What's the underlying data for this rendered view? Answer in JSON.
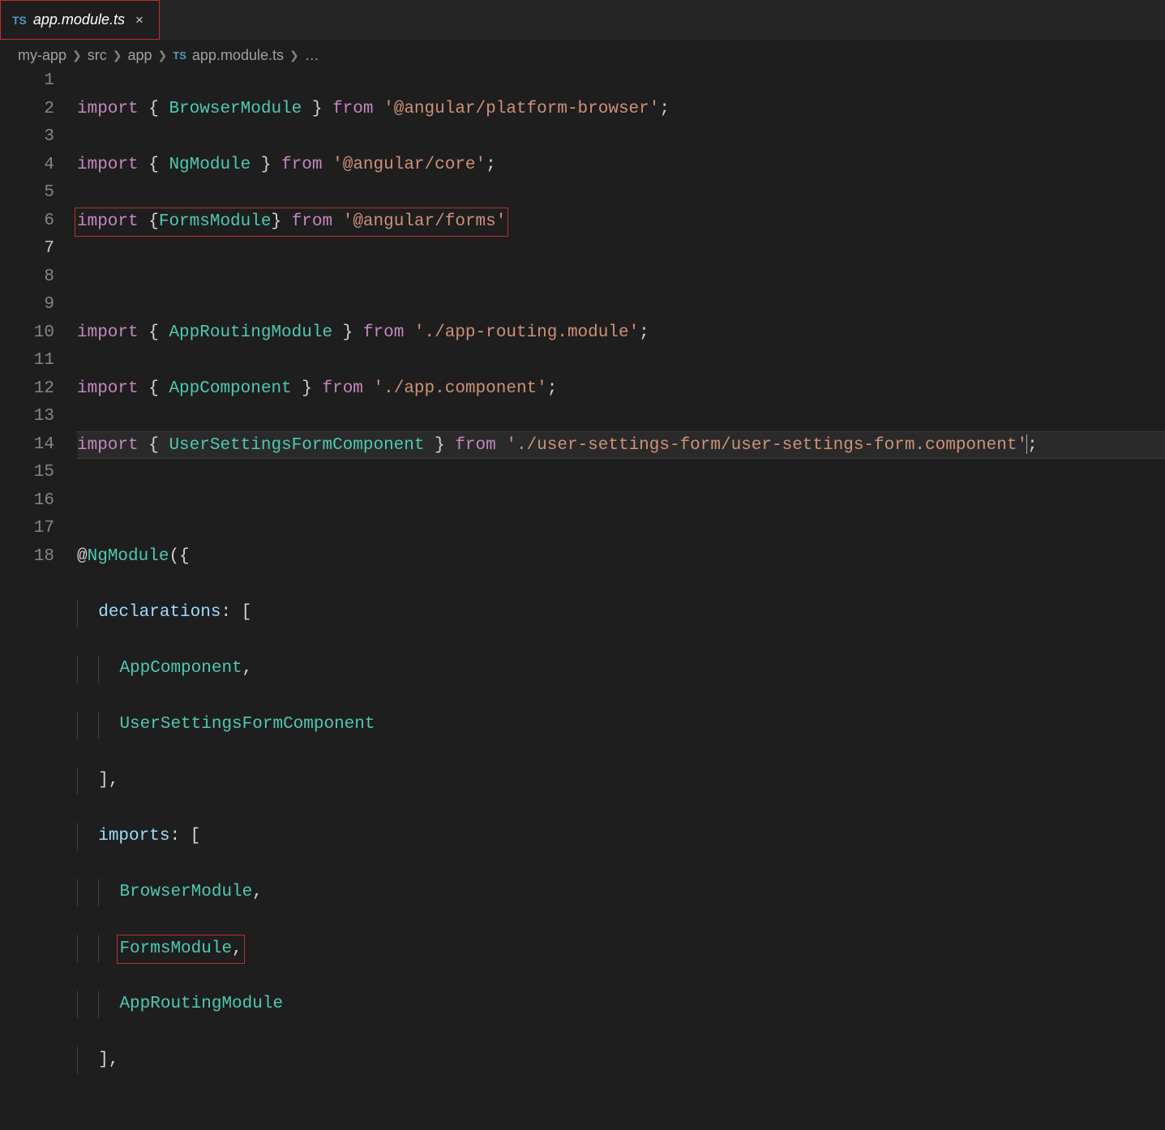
{
  "tab": {
    "icon_label": "TS",
    "title": "app.module.ts",
    "close_glyph": "×"
  },
  "breadcrumb": {
    "items": [
      "my-app",
      "src",
      "app"
    ],
    "file_icon": "TS",
    "file": "app.module.ts",
    "trailing": "…"
  },
  "gutter": {
    "start": 1,
    "end": 18,
    "active": 7
  },
  "code": {
    "l1": {
      "kw1": "import",
      "p1": " { ",
      "t1": "BrowserModule",
      "p2": " } ",
      "kw2": "from",
      "sp": " ",
      "s1": "'@angular/platform-browser'",
      "end": ";"
    },
    "l2": {
      "kw1": "import",
      "p1": " { ",
      "t1": "NgModule",
      "p2": " } ",
      "kw2": "from",
      "sp": " ",
      "s1": "'@angular/core'",
      "end": ";"
    },
    "l3": {
      "kw1": "import",
      "p1": " {",
      "t1": "FormsModule",
      "p2": "} ",
      "kw2": "from",
      "sp": " ",
      "s1": "'@angular/forms'"
    },
    "l5": {
      "kw1": "import",
      "p1": " { ",
      "t1": "AppRoutingModule",
      "p2": " } ",
      "kw2": "from",
      "sp": " ",
      "s1": "'./app-routing.module'",
      "end": ";"
    },
    "l6": {
      "kw1": "import",
      "p1": " { ",
      "t1": "AppComponent",
      "p2": " } ",
      "kw2": "from",
      "sp": " ",
      "s1": "'./app.component'",
      "end": ";"
    },
    "l7": {
      "kw1": "import",
      "p1": " { ",
      "t1": "UserSettingsFormComponent",
      "p2": " } ",
      "kw2": "from",
      "sp": " ",
      "s1": "'./user-settings-form/user-settings-form.component'",
      "end": ";"
    },
    "l9": {
      "at": "@",
      "t1": "NgModule",
      "p1": "({"
    },
    "l10": {
      "prop": "declarations",
      "p1": ": ["
    },
    "l11": {
      "t1": "AppComponent",
      "p1": ","
    },
    "l12": {
      "t1": "UserSettingsFormComponent"
    },
    "l13": {
      "p1": "],"
    },
    "l14": {
      "prop": "imports",
      "p1": ": ["
    },
    "l15": {
      "t1": "BrowserModule",
      "p1": ","
    },
    "l16": {
      "t1": "FormsModule",
      "p1": ","
    },
    "l17": {
      "t1": "AppRoutingModule"
    },
    "l18": {
      "p1": "],"
    }
  }
}
